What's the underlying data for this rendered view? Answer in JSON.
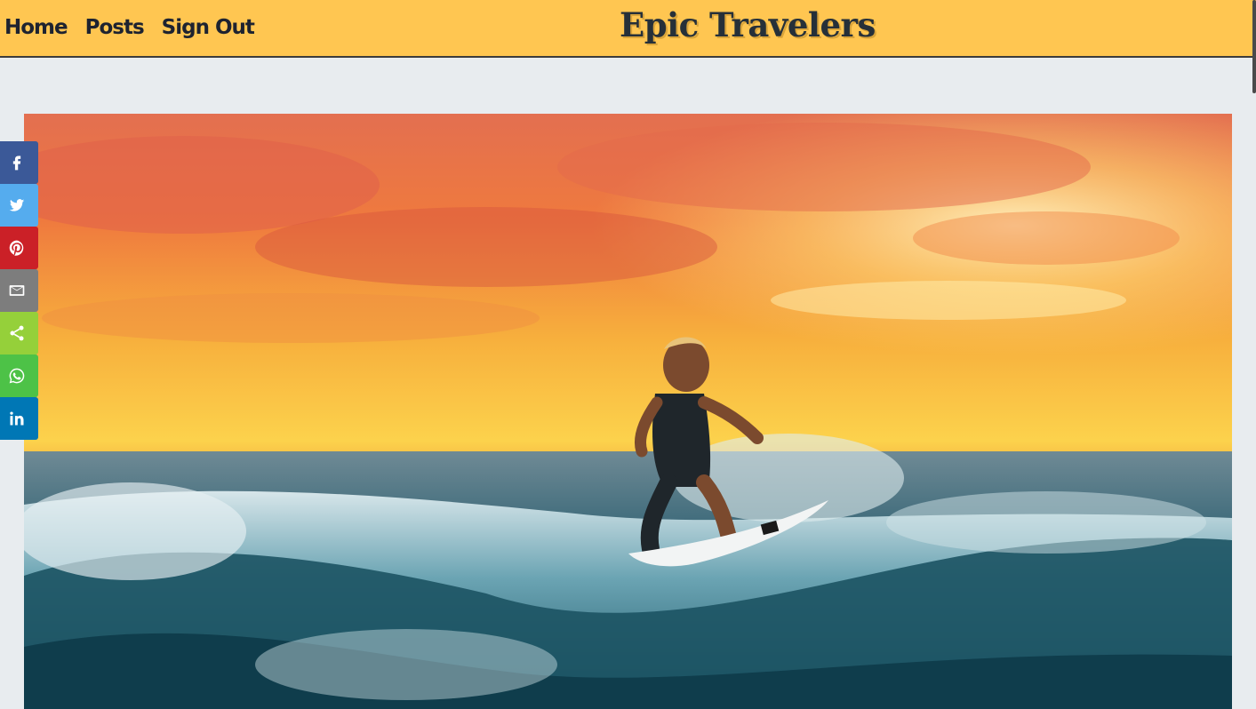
{
  "nav": {
    "items": [
      {
        "label": "Home"
      },
      {
        "label": "Posts"
      },
      {
        "label": "Sign Out"
      }
    ]
  },
  "brand": {
    "title": "Epic Travelers"
  },
  "hero": {
    "image_icon": "surfer-sunset-photo"
  },
  "share_bar": {
    "buttons": [
      {
        "name": "facebook",
        "icon": "facebook-icon",
        "color": "#3b5998"
      },
      {
        "name": "twitter",
        "icon": "twitter-icon",
        "color": "#55acee"
      },
      {
        "name": "pinterest",
        "icon": "pinterest-icon",
        "color": "#cb2027"
      },
      {
        "name": "email",
        "icon": "email-icon",
        "color": "#7d7d7d"
      },
      {
        "name": "share",
        "icon": "share-icon",
        "color": "#95d03a"
      },
      {
        "name": "whatsapp",
        "icon": "whatsapp-icon",
        "color": "#4dc247"
      },
      {
        "name": "linkedin",
        "icon": "linkedin-icon",
        "color": "#0077b5"
      }
    ]
  },
  "colors": {
    "header_bg": "#ffc651",
    "page_bg": "#e8ecef",
    "brand_text": "#263039"
  }
}
